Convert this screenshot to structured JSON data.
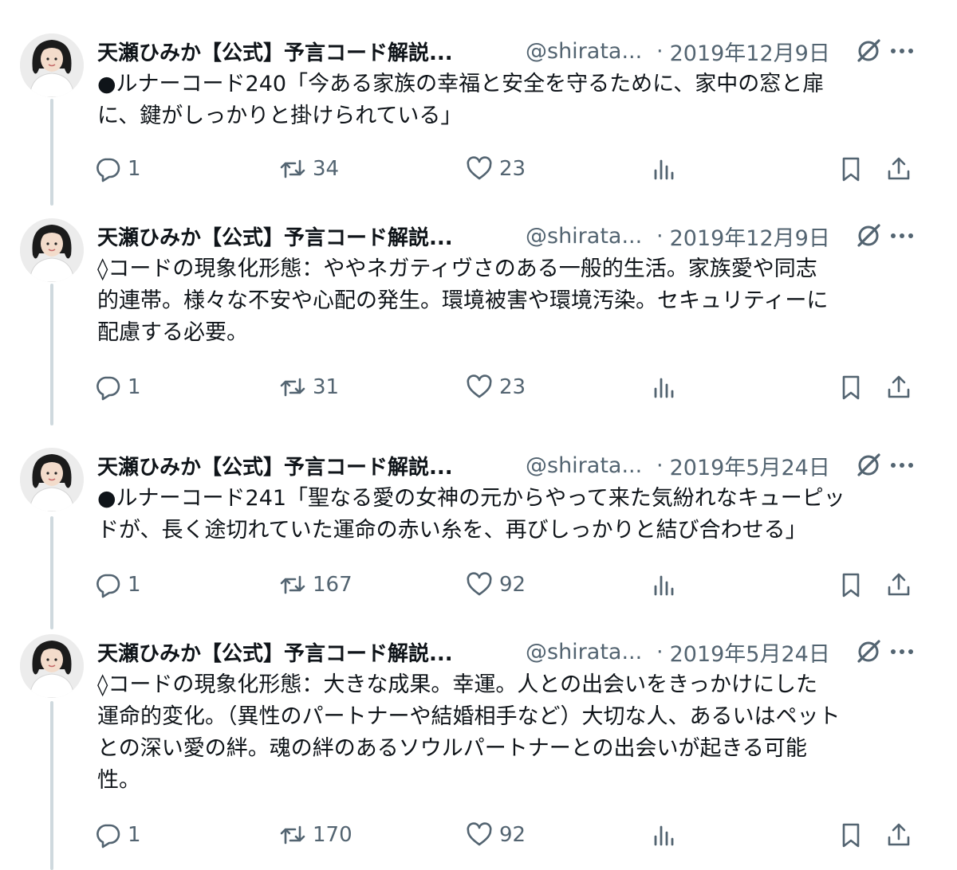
{
  "tweets": [
    {
      "name": "天瀬ひみか【公式】予言コード解説...",
      "handle": "@shirata...",
      "separator": "·",
      "date": "2019年12月9日",
      "text": "●ルナーコード240「今ある家族の幸福と安全を守るために、家中の窓と扉\nに、鍵がしっかりと掛けられている」",
      "replies": "1",
      "retweets": "34",
      "likes": "23"
    },
    {
      "name": "天瀬ひみか【公式】予言コード解説...",
      "handle": "@shirata...",
      "separator": "·",
      "date": "2019年12月9日",
      "text": "◊コードの現象化形態：ややネガティヴさのある一般的生活。家族愛や同志\n的連帯。様々な不安や心配の発生。環境被害や環境汚染。セキュリティーに\n配慮する必要。",
      "replies": "1",
      "retweets": "31",
      "likes": "23"
    },
    {
      "name": "天瀬ひみか【公式】予言コード解説...",
      "handle": "@shirata...",
      "separator": "·",
      "date": "2019年5月24日",
      "text": "●ルナーコード241「聖なる愛の女神の元からやって来た気紛れなキューピッ\nドが、長く途切れていた運命の赤い糸を、再びしっかりと結び合わせる」",
      "replies": "1",
      "retweets": "167",
      "likes": "92"
    },
    {
      "name": "天瀬ひみか【公式】予言コード解説...",
      "handle": "@shirata...",
      "separator": "·",
      "date": "2019年5月24日",
      "text": "◊コードの現象化形態：大きな成果。幸運。人との出会いをきっかけにした\n運命的変化。（異性のパートナーや結婚相手など）大切な人、あるいはペット\nとの深い愛の絆。魂の絆のあるソウルパートナーとの出会いが起きる可能\n性。",
      "replies": "1",
      "retweets": "170",
      "likes": "92"
    }
  ],
  "icons": {
    "reply": "reply-icon",
    "retweet": "retweet-icon",
    "like": "heart-icon",
    "views": "views-icon",
    "bookmark": "bookmark-icon",
    "share": "share-icon",
    "grok": "grok-icon",
    "more": "more-icon"
  },
  "colors": {
    "text": "#0f1419",
    "secondary": "#536471",
    "thread_line": "#cfd9de"
  }
}
